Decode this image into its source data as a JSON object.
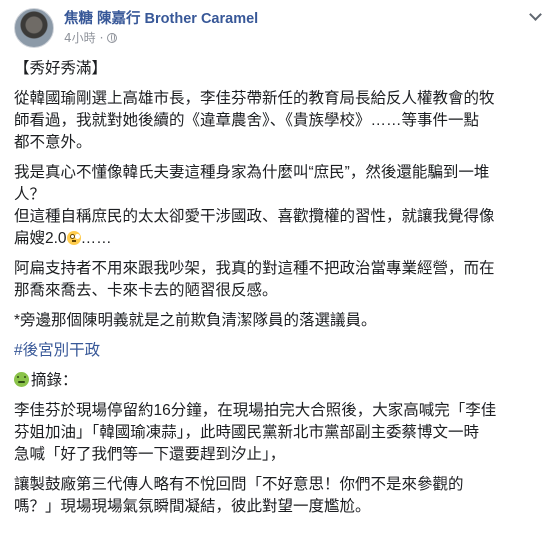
{
  "post": {
    "author": "焦糖 陳嘉行 Brother Caramel",
    "timestamp": "4小時",
    "separator": "·",
    "privacy_icon": "globe-icon",
    "menu_icon": "chevron-down-icon",
    "heading": "【秀好秀滿】",
    "p1_line1": "從韓國瑜剛選上高雄市長，李佳芬帶新任的教育局長給反人權教會的牧",
    "p1_line2": "師看過，我就對她後續的《違章農舍》、《貴族學校》……等事件一點",
    "p1_line3": "都不意外。",
    "p2_line1": "我是真心不懂像韓氏夫妻這種身家為什麼叫“庶民”，然後還能騙到一堆",
    "p2_line2": "人？",
    "p3_line1": "但這種自稱庶民的太太卻愛干涉國政、喜歡攬權的習性，就讓我覺得像",
    "p3_line2_text": "扁嫂2.0",
    "p3_line2_suffix": "……",
    "p3_emoji": "face-with-rolling-eyes-icon",
    "p4_line1": "阿扁支持者不用來跟我吵架，我真的對這種不把政治當專業經營，而在",
    "p4_line2": "那喬來喬去、卡來卡去的陋習很反感。",
    "p5_line1": "*旁邊那個陳明義就是之前欺負清潔隊員的落選議員。",
    "hashtag": "#後宮別干政",
    "excerpt_emoji": "nauseated-face-icon",
    "excerpt_label": "摘錄：",
    "q1_line1": "李佳芬於現場停留約16分鐘，在現場拍完大合照後，大家高喊完「李佳",
    "q1_line2": "芬姐加油」「韓國瑜凍蒜」，此時國民黨新北市黨部副主委蔡博文一時",
    "q1_line3": "急喊「好了我們等一下還要趕到汐止」，",
    "q2_line1": "讓製鼓廠第三代傳人略有不悅回問「不好意思！你們不是來參觀的",
    "q2_line2": "嗎？」現場現場氣氛瞬間凝結，彼此對望一度尷尬。"
  },
  "colors": {
    "author_link": "#385898",
    "hashtag": "#385898",
    "meta_gray": "#90949c",
    "text": "#1c1e21"
  }
}
